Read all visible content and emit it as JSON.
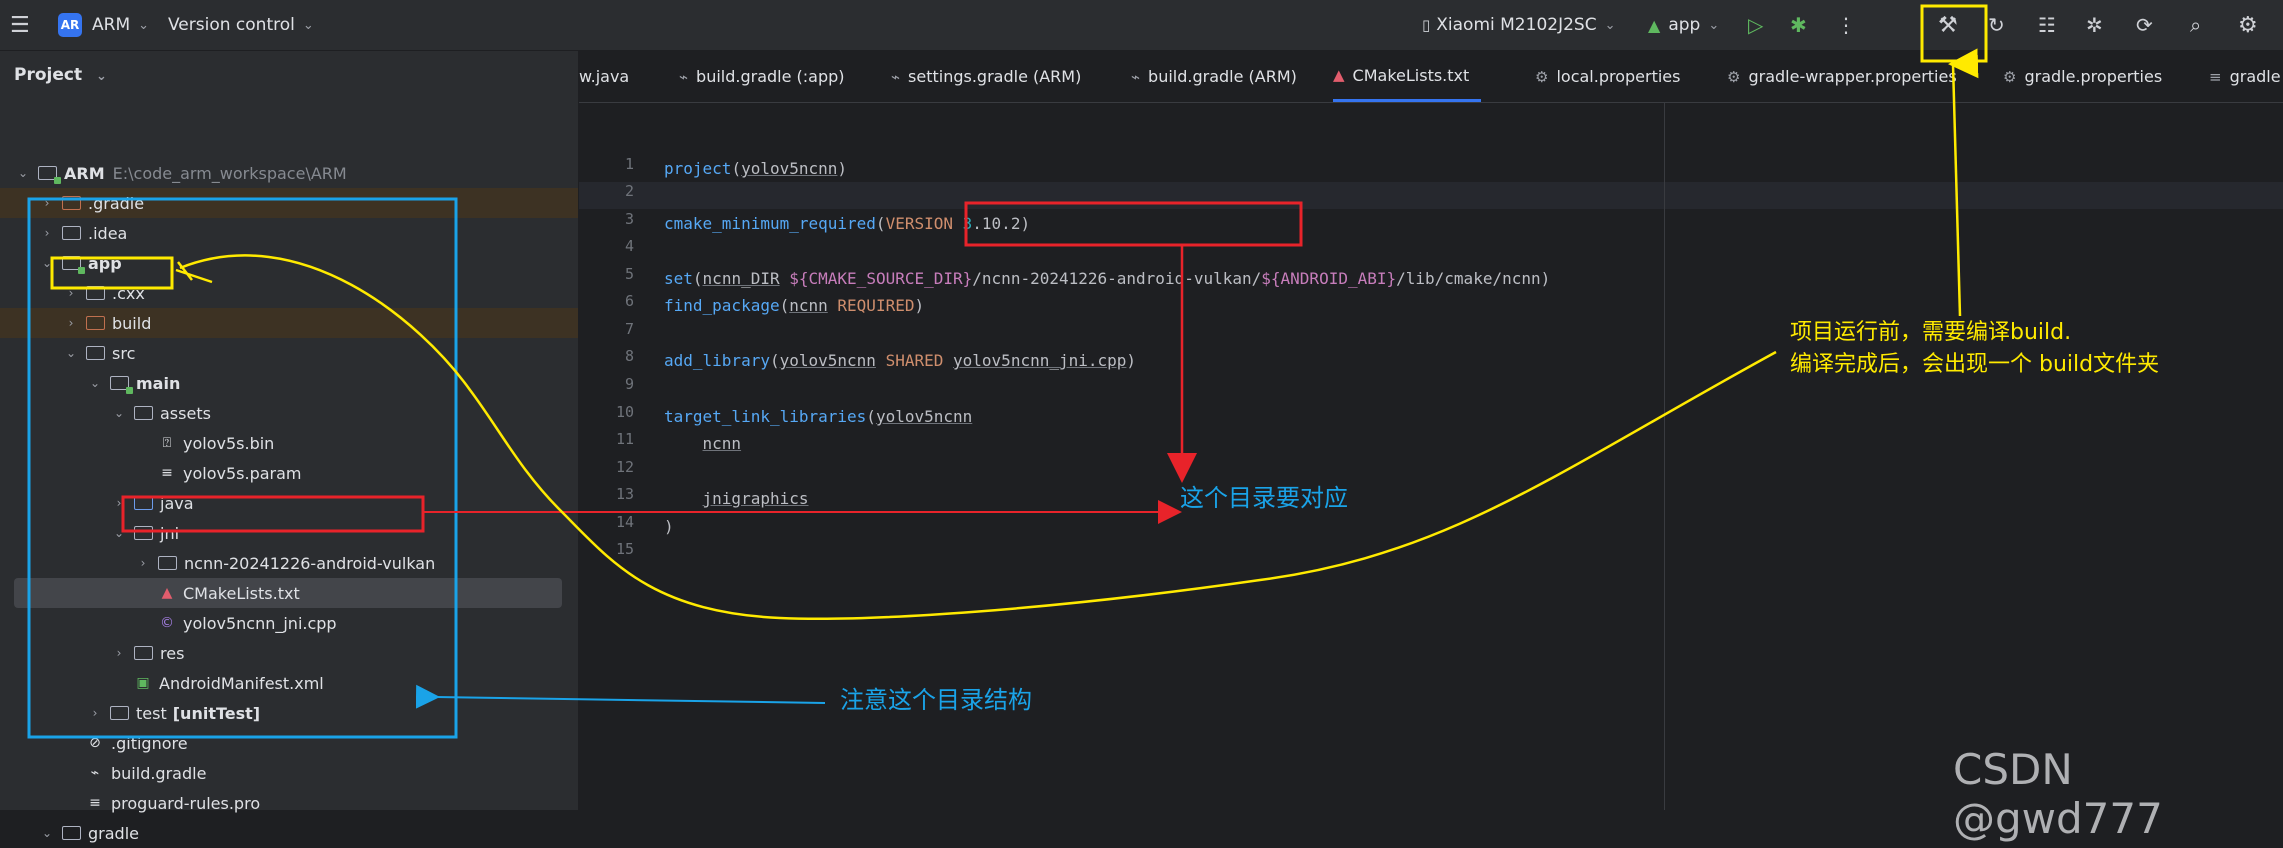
{
  "toolbar": {
    "project_badge": "AR",
    "project_name": "ARM",
    "vcs_label": "Version control",
    "device_label": "Xiaomi M2102J2SC",
    "run_config_label": "app"
  },
  "project_panel": {
    "title": "Project",
    "rows": [
      {
        "label": "ARM",
        "suffix": "E:\\code_arm_workspace\\ARM"
      },
      {
        "label": ".gradle"
      },
      {
        "label": ".idea"
      },
      {
        "label": "app"
      },
      {
        "label": ".cxx"
      },
      {
        "label": "build"
      },
      {
        "label": "src"
      },
      {
        "label": "main"
      },
      {
        "label": "assets"
      },
      {
        "label": "yolov5s.bin"
      },
      {
        "label": "yolov5s.param"
      },
      {
        "label": "java"
      },
      {
        "label": "jni"
      },
      {
        "label": "ncnn-20241226-android-vulkan"
      },
      {
        "label": "CMakeLists.txt"
      },
      {
        "label": "yolov5ncnn_jni.cpp"
      },
      {
        "label": "res"
      },
      {
        "label": "AndroidManifest.xml"
      },
      {
        "label": "test",
        "suffix": "[unitTest]"
      },
      {
        "label": ".gitignore"
      },
      {
        "label": "build.gradle"
      },
      {
        "label": "proguard-rules.pro"
      },
      {
        "label": "gradle"
      }
    ]
  },
  "editor": {
    "tabs": [
      {
        "label": "w.java"
      },
      {
        "label": "build.gradle (:app)"
      },
      {
        "label": "settings.gradle (ARM)"
      },
      {
        "label": "build.gradle (ARM)"
      },
      {
        "label": "CMakeLists.txt"
      },
      {
        "label": "local.properties"
      },
      {
        "label": "gradle-wrapper.properties"
      },
      {
        "label": "gradle.properties"
      },
      {
        "label": "gradle"
      }
    ],
    "line_numbers": [
      "1",
      "2",
      "3",
      "4",
      "5",
      "6",
      "7",
      "8",
      "9",
      "10",
      "11",
      "12",
      "13",
      "14",
      "15"
    ],
    "code": {
      "l1_fn": "project",
      "l1_arg": "yolov5ncnn",
      "l3_fn": "cmake_minimum_required",
      "l3_kw": "VERSION",
      "l3_num_a": "3",
      "l3_num_b": ".10.2",
      "l5_fn": "set",
      "l5_var": "ncnn_DIR",
      "l5_a": "${CMAKE_SOURCE_DIR}",
      "l5_b": "/ncnn-20241226-android-vulkan/",
      "l5_c": "${ANDROID_ABI}",
      "l5_d": "/lib/cmake/ncnn",
      "l6_fn": "find_package",
      "l6_arg": "ncnn",
      "l6_kw": "REQUIRED",
      "l8_fn": "add_library",
      "l8_arg": "yolov5ncnn",
      "l8_kw": "SHARED",
      "l8_src": "yolov5ncnn_jni.cpp",
      "l10_fn": "target_link_libraries",
      "l10_arg": "yolov5ncnn",
      "l11": "ncnn",
      "l13": "jnigraphics",
      "l14": ")"
    }
  },
  "annotations": {
    "dir_match": "这个目录要对应",
    "note_structure": "注意这个目录结构",
    "build_note_line1": "项目运行前，需要编译build.",
    "build_note_line2": "编译完成后，会出现一个 build文件夹",
    "colors": {
      "red": "#e8232a",
      "blue": "#1aa3e8",
      "yellow": "#ffea00"
    }
  },
  "watermark": "CSDN @gwd777"
}
